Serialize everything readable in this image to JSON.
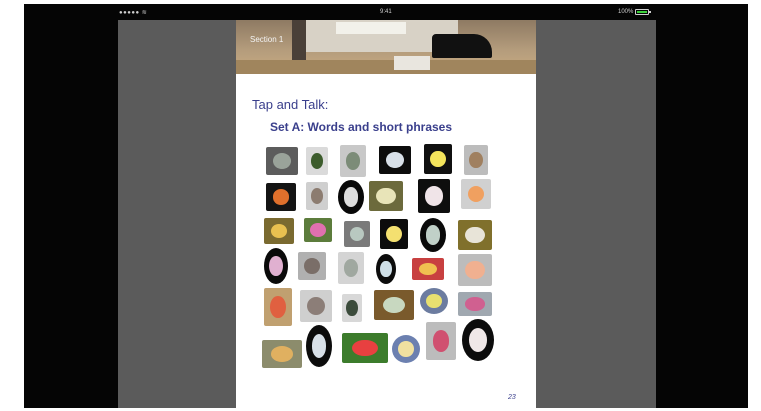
{
  "status_bar": {
    "carrier": "●●●●● ≋",
    "time": "9:41",
    "battery": "100%"
  },
  "banner": {
    "section_label": "Section 1"
  },
  "title": "Tap and Talk:",
  "subtitle": "Set A: Words and short phrases",
  "page_number": "23",
  "colors": {
    "device_frame": "#050505",
    "side_panels": "#5b5b5b",
    "heading": "#3a3f8c"
  },
  "thumbnails": [
    {
      "label": "flower-picture-1",
      "bg": "#5c5c5c",
      "fg": "#9aa39a"
    },
    {
      "label": "flower-picture-2",
      "bg": "#dadada",
      "fg": "#3c5c2c"
    },
    {
      "label": "flower-picture-3",
      "bg": "#c8c8c8",
      "fg": "#7c8c78"
    },
    {
      "label": "flower-picture-4",
      "bg": "#0c0c0c",
      "fg": "#d8e0e8"
    },
    {
      "label": "flower-picture-5",
      "bg": "#101010",
      "fg": "#f4e45c"
    },
    {
      "label": "flower-picture-6",
      "bg": "#bcbcbc",
      "fg": "#a08060"
    },
    {
      "label": "flower-picture-7",
      "bg": "#141414",
      "fg": "#e0702c"
    },
    {
      "label": "flower-picture-8",
      "bg": "#cfcfcf",
      "fg": "#8c7c70"
    },
    {
      "label": "flower-picture-9",
      "bg": "#080808",
      "fg": "#dcdcdc"
    },
    {
      "label": "flower-picture-10",
      "bg": "#6c6a3c",
      "fg": "#e8e4b8"
    },
    {
      "label": "flower-picture-11",
      "bg": "#0e0e0e",
      "fg": "#f0e4e8"
    },
    {
      "label": "flower-picture-12",
      "bg": "#d0d0d0",
      "fg": "#f0a060"
    },
    {
      "label": "flower-picture-13",
      "bg": "#7a6a30",
      "fg": "#e8c050"
    },
    {
      "label": "flower-picture-14",
      "bg": "#5c7c3c",
      "fg": "#e070b0"
    },
    {
      "label": "flower-picture-15",
      "bg": "#7a7a7a",
      "fg": "#b8c8c0"
    },
    {
      "label": "flower-picture-16",
      "bg": "#0c0c0c",
      "fg": "#f4e070"
    },
    {
      "label": "flower-picture-17",
      "bg": "#0a0a0a",
      "fg": "#c0d0c8"
    },
    {
      "label": "flower-picture-18",
      "bg": "#80702c",
      "fg": "#e8e4d8"
    },
    {
      "label": "flower-picture-19",
      "bg": "#0a0a0a",
      "fg": "#e0b0d0"
    },
    {
      "label": "flower-picture-20",
      "bg": "#b0b0b0",
      "fg": "#7a6e68"
    },
    {
      "label": "flower-picture-21",
      "bg": "#d4d4d4",
      "fg": "#a0a8a0"
    },
    {
      "label": "flower-picture-22",
      "bg": "#0c0c0c",
      "fg": "#d0e0e8"
    },
    {
      "label": "flower-picture-23",
      "bg": "#c84040",
      "fg": "#f0c050"
    },
    {
      "label": "flower-picture-24",
      "bg": "#bcbcbc",
      "fg": "#f0b090"
    },
    {
      "label": "flower-picture-25",
      "bg": "#c0a070",
      "fg": "#e06040"
    },
    {
      "label": "flower-picture-26",
      "bg": "#cfcfcf",
      "fg": "#8c7e78"
    },
    {
      "label": "flower-picture-27",
      "bg": "#d8d8d8",
      "fg": "#3c4c3c"
    },
    {
      "label": "flower-picture-28",
      "bg": "#7a5a2c",
      "fg": "#c8d8c0"
    },
    {
      "label": "flower-picture-29",
      "bg": "#6c7ca0",
      "fg": "#e8e070"
    },
    {
      "label": "flower-picture-30",
      "bg": "#a0a8b0",
      "fg": "#d06090"
    },
    {
      "label": "flower-picture-31",
      "bg": "#8c8c6c",
      "fg": "#e0b060"
    },
    {
      "label": "flower-picture-32",
      "bg": "#0c0c0c",
      "fg": "#d8e0e8"
    },
    {
      "label": "flower-picture-33",
      "bg": "#3c7c2c",
      "fg": "#e84040"
    },
    {
      "label": "flower-picture-34",
      "bg": "#6c80b0",
      "fg": "#f0e0a0"
    },
    {
      "label": "flower-picture-35",
      "bg": "#bcbcbc",
      "fg": "#d05070"
    },
    {
      "label": "flower-picture-36",
      "bg": "#0c0c0c",
      "fg": "#f0e8e8"
    }
  ]
}
